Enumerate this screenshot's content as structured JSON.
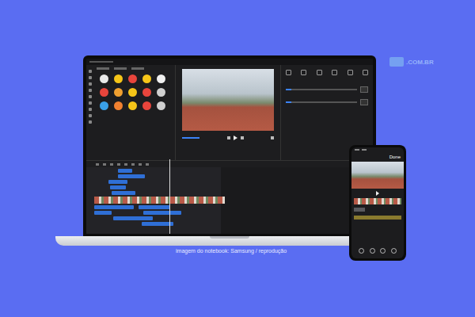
{
  "watermark": ".COM.BR",
  "caption": "imagem do notebook: Samsung / reprodução",
  "phone": {
    "header_action": "Done"
  },
  "properties": {
    "sliders": [
      {
        "level": 0.08
      },
      {
        "level": 0.08
      }
    ]
  }
}
